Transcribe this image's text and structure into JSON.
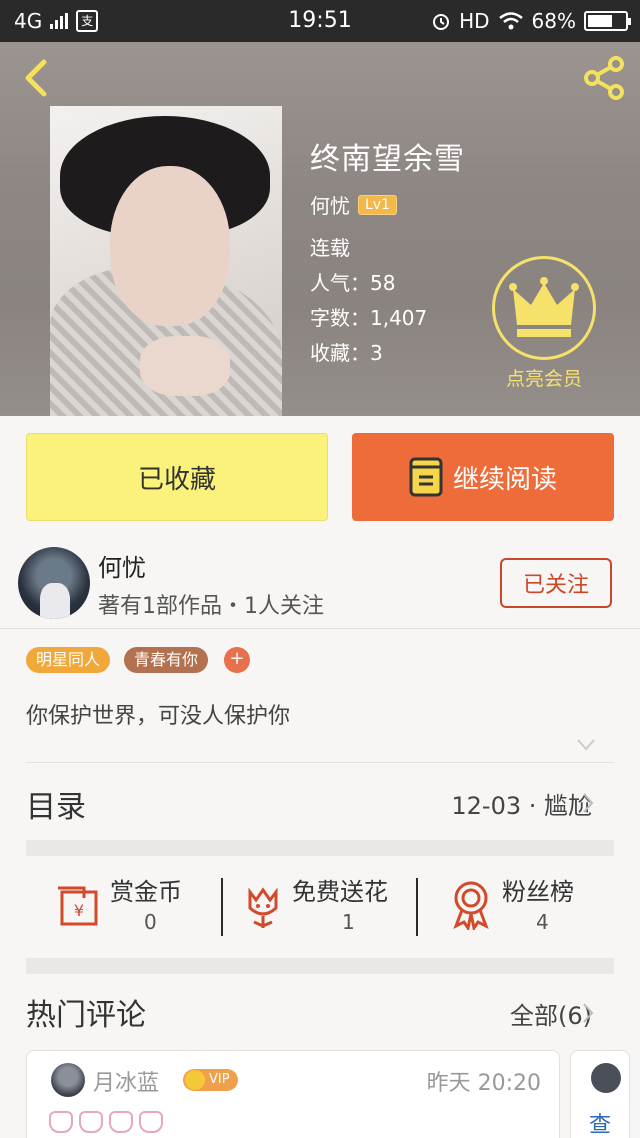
{
  "status_bar": {
    "network": "4G",
    "app_badge": "支",
    "time": "19:51",
    "hd": "HD",
    "battery": "68%",
    "battery_level": 0.68
  },
  "header": {
    "book_title": "终南望余雪",
    "author": "何忧",
    "level": "Lv1",
    "status": "连载",
    "popularity": "人气：58",
    "word_count": "字数：1,407",
    "favorites": "收藏：3",
    "vip_label": "点亮会员"
  },
  "actions": {
    "collect_label": "已收藏",
    "read_label": "继续阅读"
  },
  "author_card": {
    "name": "何忧",
    "subtitle": "著有1部作品・1人关注",
    "follow_label": "已关注"
  },
  "tags": [
    {
      "label": "明星同人",
      "color": "#f0a83a"
    },
    {
      "label": "青春有你",
      "color": "#b4714f"
    }
  ],
  "tag_add": "+",
  "intro": "你保护世界，可没人保护你",
  "toc": {
    "title": "目录",
    "latest": "12-03 · 尴尬"
  },
  "stats": [
    {
      "label": "赏金币",
      "value": "0",
      "icon": "red-envelope-icon"
    },
    {
      "label": "免费送花",
      "value": "1",
      "icon": "flower-icon"
    },
    {
      "label": "粉丝榜",
      "value": "4",
      "icon": "medal-icon"
    }
  ],
  "hot_comments": {
    "title": "热门评论",
    "all_label": "全部(6)"
  },
  "comment": {
    "user": "月冰蓝",
    "vip": "VIP",
    "time": "昨天 20:20"
  },
  "comment2_partial": "查",
  "colors": {
    "accent_orange": "#ed6c3a",
    "collect_yellow": "#fbf27c",
    "follow_red": "#c8482a",
    "vip_gold": "#f6e26a"
  }
}
